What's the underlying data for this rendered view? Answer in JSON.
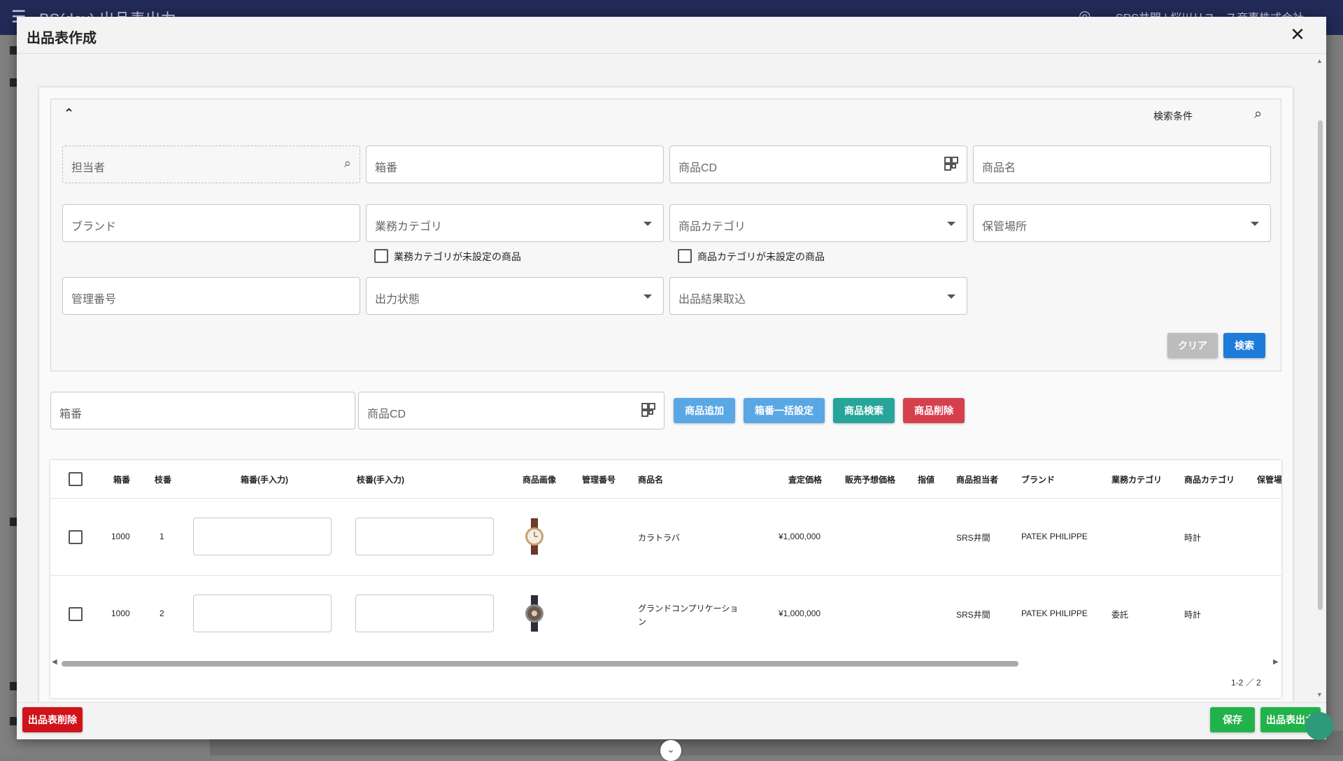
{
  "background": {
    "app_title": "BS(dev) 出品表出力",
    "user": "SRS井間 | 桜川リユース商事株式会社"
  },
  "dialog": {
    "title": "出品表作成",
    "close_icon": "close-icon"
  },
  "search": {
    "condition_label": "検索条件",
    "fields": {
      "tantousha": "担当者",
      "hakoban": "箱番",
      "shohin_cd": "商品CD",
      "shohin_mei": "商品名",
      "brand": "ブランド",
      "gyomu_category": "業務カテゴリ",
      "shohin_category": "商品カテゴリ",
      "hokan_basho": "保管場所",
      "kanri_bango": "管理番号",
      "shutsuryoku_jotai": "出力状態",
      "shuppin_kekka": "出品結果取込"
    },
    "checkboxes": {
      "gyomu_unset": "業務カテゴリが未設定の商品",
      "shohin_unset": "商品カテゴリが未設定の商品"
    },
    "clear_label": "クリア",
    "search_label": "検索"
  },
  "toolbar": {
    "hakoban_placeholder": "箱番",
    "shohin_cd_placeholder": "商品CD",
    "add_label": "商品追加",
    "bulk_label": "箱番一括設定",
    "find_label": "商品検索",
    "delete_label": "商品削除"
  },
  "table": {
    "headers": [
      "箱番",
      "枝番",
      "箱番(手入力)",
      "枝番(手入力)",
      "商品画像",
      "管理番号",
      "商品名",
      "査定価格",
      "販売予想価格",
      "指値",
      "商品担当者",
      "ブランド",
      "業務カテゴリ",
      "商品カテゴリ",
      "保管場"
    ],
    "rows": [
      {
        "hakoban": "1000",
        "edaban": "1",
        "name": "カラトラバ",
        "name2": "",
        "price": "¥1,000,000",
        "tanto": "SRS井間",
        "brand": "PATEK PHILIPPE",
        "gyomu": "",
        "category": "時計"
      },
      {
        "hakoban": "1000",
        "edaban": "2",
        "name": "グランドコンプリケーショ",
        "name2": "ン",
        "price": "¥1,000,000",
        "tanto": "SRS井間",
        "brand": "PATEK PHILIPPE",
        "gyomu": "委託",
        "category": "時計"
      }
    ],
    "pager": "1-2 ／ 2"
  },
  "footer": {
    "delete_sheet": "出品表削除",
    "save": "保存",
    "output": "出品表出力"
  },
  "colors": {
    "primary_blue": "#1f7bd8",
    "danger_red": "#d0121b",
    "success_green": "#22b24c",
    "teal": "#27a59a"
  }
}
